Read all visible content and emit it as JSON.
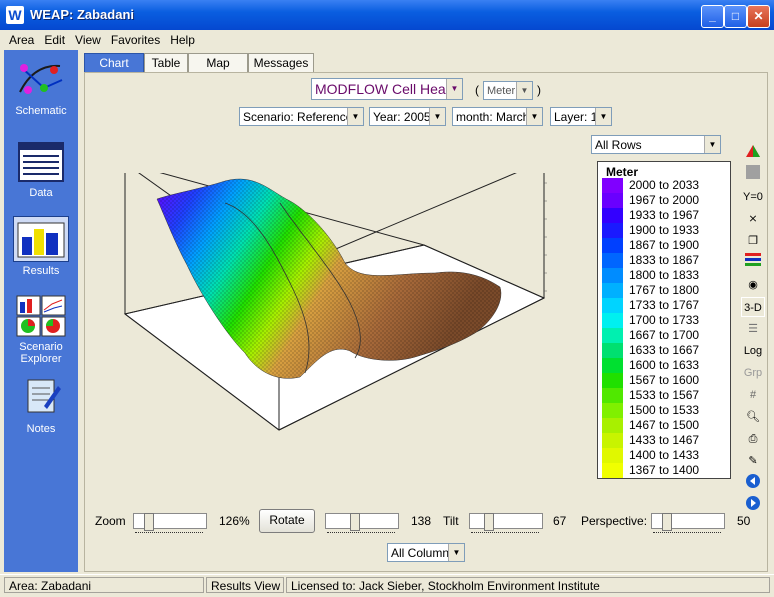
{
  "window": {
    "title": "WEAP: Zabadani",
    "app_icon": "W"
  },
  "menu": [
    "Area",
    "Edit",
    "View",
    "Favorites",
    "Help"
  ],
  "sidebar": [
    {
      "label": "Schematic",
      "icon": "schematic-icon"
    },
    {
      "label": "Data",
      "icon": "data-icon"
    },
    {
      "label": "Results",
      "icon": "results-icon"
    },
    {
      "label": "Scenario Explorer",
      "icon": "scenario-explorer-icon"
    },
    {
      "label": "Notes",
      "icon": "notes-icon"
    }
  ],
  "tabs": [
    "Chart",
    "Table",
    "Map",
    "Messages"
  ],
  "selectors": {
    "variable": "MODFLOW Cell Head",
    "unit": "Meter",
    "scenario": "Scenario: Reference",
    "year": "Year: 2005",
    "month": "month: March",
    "layer": "Layer: 1",
    "rows": "All Rows",
    "columns": "All Columns"
  },
  "legend": {
    "title": "Meter",
    "items": [
      {
        "label": "2000 to 2033",
        "color": "#8000ff"
      },
      {
        "label": "1967 to 2000",
        "color": "#6a00ff"
      },
      {
        "label": "1933 to 1967",
        "color": "#3300ff"
      },
      {
        "label": "1900 to 1933",
        "color": "#1a1aff"
      },
      {
        "label": "1867 to 1900",
        "color": "#0040ff"
      },
      {
        "label": "1833 to 1867",
        "color": "#0066ff"
      },
      {
        "label": "1800 to 1833",
        "color": "#008cff"
      },
      {
        "label": "1767 to 1800",
        "color": "#00b0ff"
      },
      {
        "label": "1733 to 1767",
        "color": "#00d4ff"
      },
      {
        "label": "1700 to 1733",
        "color": "#00f0f0"
      },
      {
        "label": "1667 to 1700",
        "color": "#00f0b0"
      },
      {
        "label": "1633 to 1667",
        "color": "#00e070"
      },
      {
        "label": "1600 to 1633",
        "color": "#00e030"
      },
      {
        "label": "1567 to 1600",
        "color": "#20e000"
      },
      {
        "label": "1533 to 1567",
        "color": "#50e800"
      },
      {
        "label": "1500 to 1533",
        "color": "#80f000"
      },
      {
        "label": "1467 to 1500",
        "color": "#a8f000"
      },
      {
        "label": "1433 to 1467",
        "color": "#c8f400"
      },
      {
        "label": "1400 to 1433",
        "color": "#e0f800"
      },
      {
        "label": "1367 to 1400",
        "color": "#f0ff00"
      }
    ]
  },
  "right_toolbar": [
    "",
    "",
    "Y=0",
    "",
    "",
    "",
    "",
    "3-D",
    "",
    "Log",
    "Grp",
    "",
    "",
    "",
    "",
    "",
    ""
  ],
  "controls": {
    "zoom_label": "Zoom",
    "zoom_value": "126%",
    "rotate_button": "Rotate",
    "rotate_value": "138",
    "tilt_label": "Tilt",
    "tilt_value": "67",
    "perspective_label": "Perspective:",
    "perspective_value": "50"
  },
  "status": {
    "area": "Area: Zabadani",
    "view": "Results View",
    "license": "Licensed to: Jack Sieber, Stockholm Environment Institute"
  }
}
